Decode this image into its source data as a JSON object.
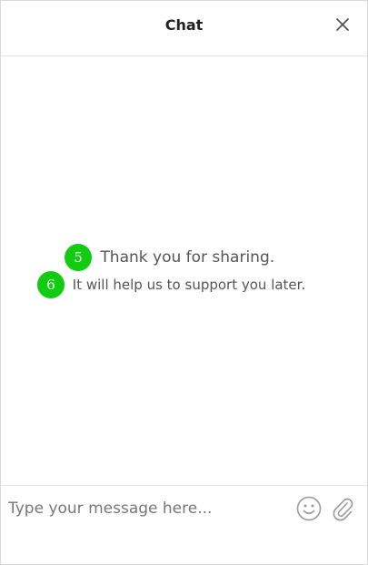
{
  "header": {
    "title": "Chat",
    "close_icon": "close-icon"
  },
  "messages": [
    {
      "badge": "5",
      "text": "Thank you for sharing."
    },
    {
      "badge": "6",
      "text": "It will help us to support you later."
    }
  ],
  "composer": {
    "placeholder": "Type your message here...",
    "value": "",
    "emoji_icon": "smiley-icon",
    "attach_icon": "paperclip-icon"
  },
  "colors": {
    "badge_green": "#12cc12",
    "border": "#d9d9d9",
    "text": "#555555"
  }
}
